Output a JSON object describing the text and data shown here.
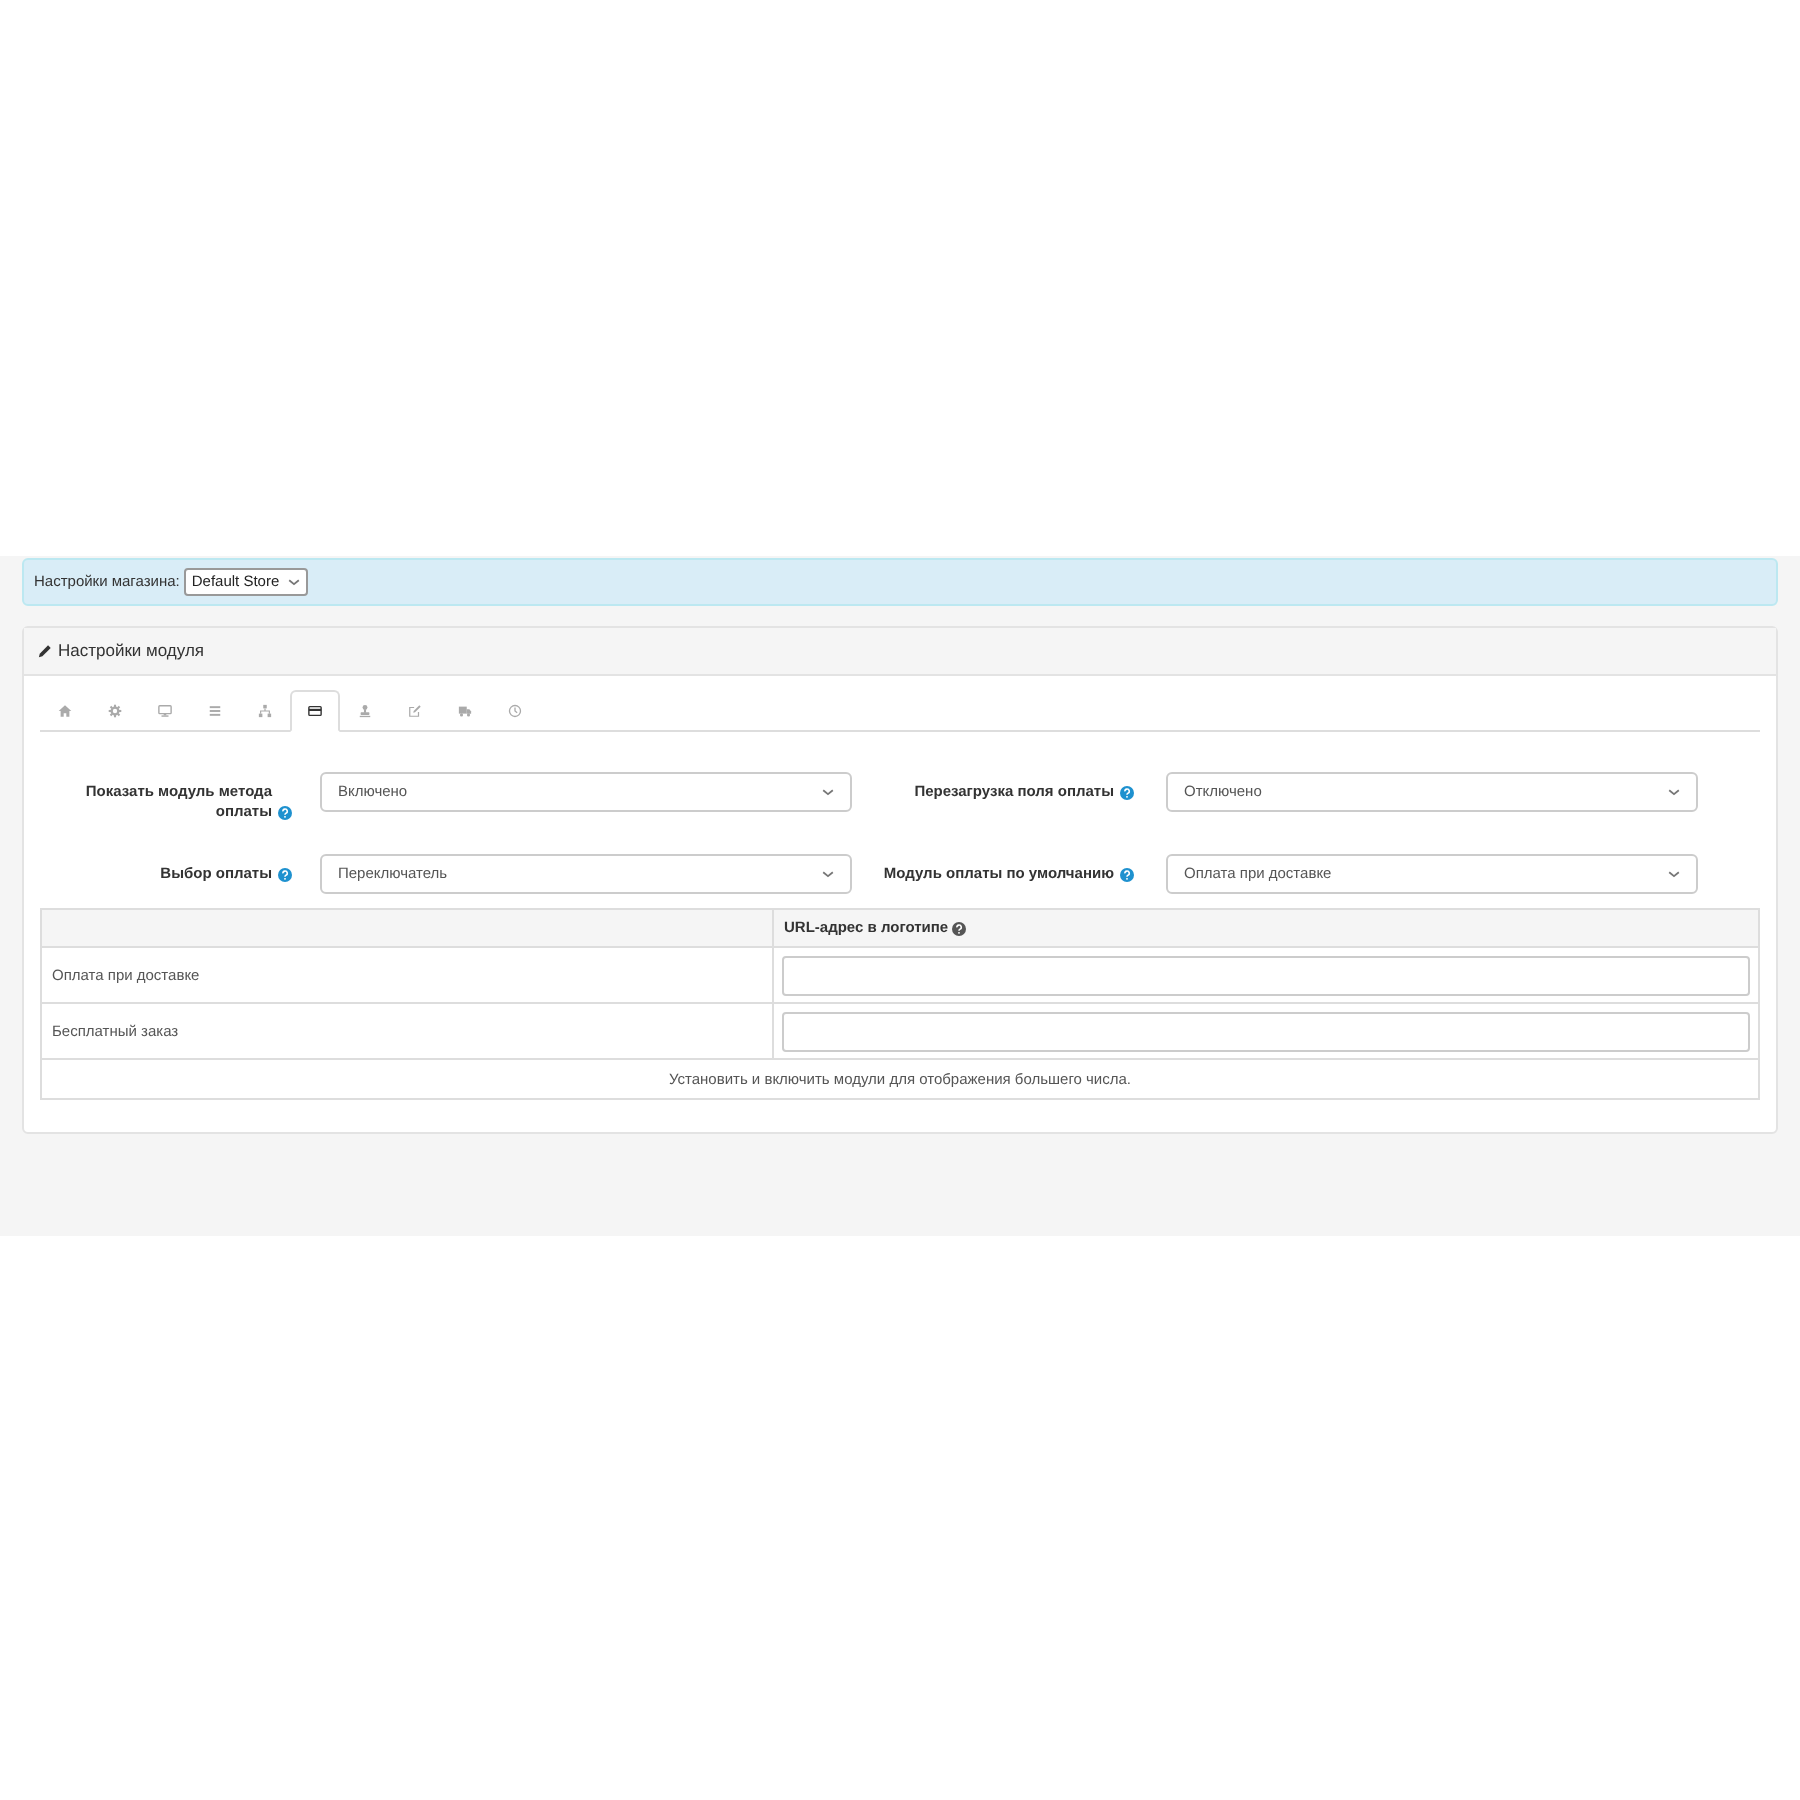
{
  "store_bar": {
    "label": "Настройки магазина:",
    "store": "Default Store"
  },
  "panel": {
    "title": "Настройки модуля",
    "tabs": [
      {
        "kind": "home",
        "selected": false
      },
      {
        "kind": "settings",
        "selected": false
      },
      {
        "kind": "monitor",
        "selected": false
      },
      {
        "kind": "list",
        "selected": false
      },
      {
        "kind": "hierarchy",
        "selected": false
      },
      {
        "kind": "card",
        "selected": true
      },
      {
        "kind": "stamp",
        "selected": false
      },
      {
        "kind": "edit",
        "selected": false
      },
      {
        "kind": "truck",
        "selected": false
      },
      {
        "kind": "clock",
        "selected": false
      }
    ],
    "settings": [
      {
        "label": "Показать модуль метода оплаты",
        "value": "Включено"
      },
      {
        "label": "Перезагрузка поля оплаты",
        "value": "Отключено"
      },
      {
        "label": "Выбор оплаты",
        "value": "Переключатель"
      },
      {
        "label": "Модуль оплаты по умолчанию",
        "value": "Оплата при доставке"
      }
    ],
    "payment_table": {
      "column_2": "URL-адрес в логотипе",
      "rows": [
        {
          "name": "Оплата при доставке"
        },
        {
          "name": "Бесплатный заказ"
        }
      ],
      "note": "Установить и включить модули для отображения большего числа."
    }
  }
}
